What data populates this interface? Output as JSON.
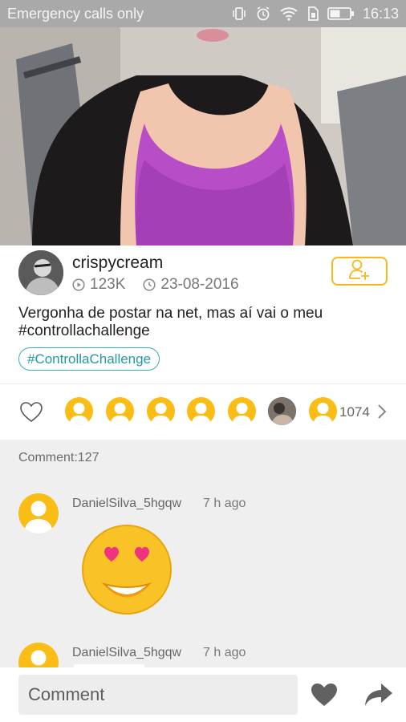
{
  "status_bar": {
    "carrier": "Emergency calls only",
    "time": "16:13",
    "icons": [
      "vibrate-icon",
      "alarm-icon",
      "wifi-icon",
      "sim-icon",
      "battery-icon"
    ]
  },
  "post": {
    "author": {
      "username": "crispycream",
      "plays": "123K",
      "date": "23-08-2016"
    },
    "caption": "Vergonha de postar na net, mas aí vai o meu #controllachallenge",
    "tag": "#ControllaChallenge"
  },
  "likes": {
    "count": "1074"
  },
  "comments": {
    "count_label": "Comment:127",
    "items": [
      {
        "user": "DanielSilva_5hgqw",
        "time": "7 h ago"
      },
      {
        "user": "DanielSilva_5hgqw",
        "time": "7 h ago"
      }
    ]
  },
  "composer": {
    "placeholder": "Comment"
  },
  "colors": {
    "accent": "#f6b91c",
    "tag": "#1e9aa1",
    "status_bar": "#a9a9a9"
  }
}
